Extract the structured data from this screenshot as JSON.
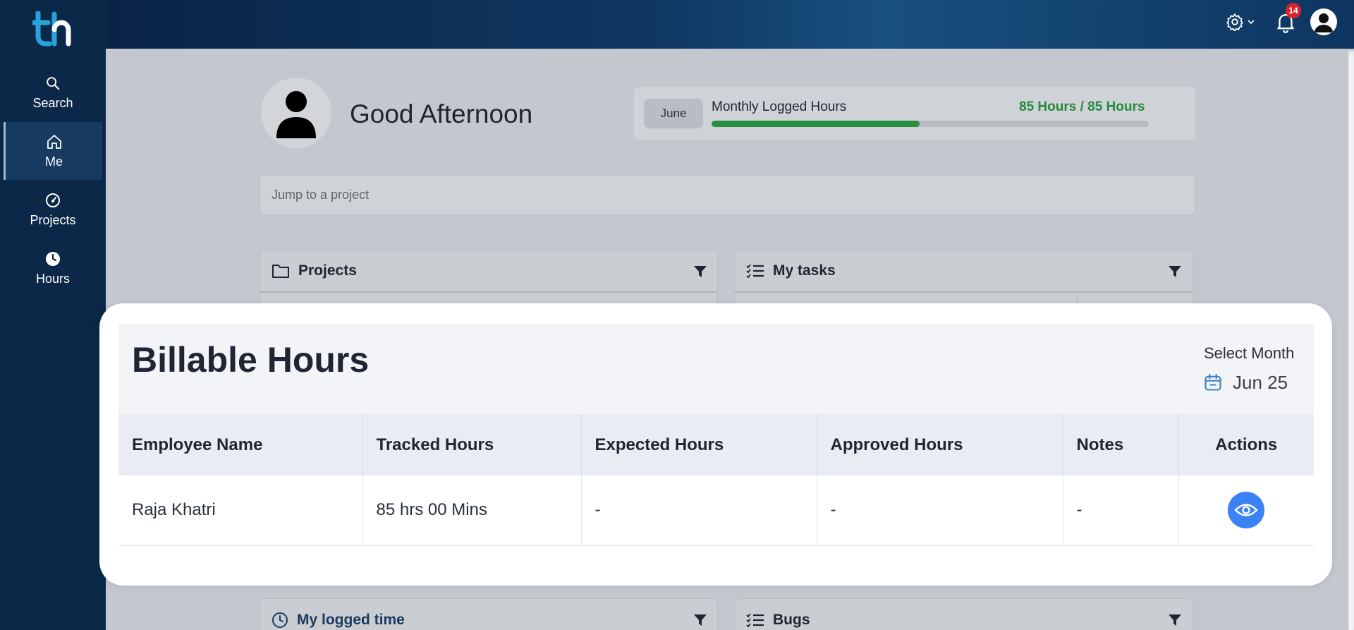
{
  "sidebar": {
    "items": [
      {
        "label": "Search",
        "icon": "search-icon"
      },
      {
        "label": "Me",
        "icon": "home-icon"
      },
      {
        "label": "Projects",
        "icon": "gauge-icon"
      },
      {
        "label": "Hours",
        "icon": "clock-icon"
      }
    ]
  },
  "topbar": {
    "notification_count": "14"
  },
  "greeting": {
    "text": "Good Afternoon"
  },
  "monthly_hours": {
    "month": "June",
    "label": "Monthly Logged Hours",
    "value": "85 Hours / 85 Hours",
    "progress_fraction": 0.475
  },
  "jump": {
    "placeholder": "Jump to a project"
  },
  "panels": {
    "projects": "Projects",
    "my_tasks": "My tasks",
    "my_logged_time": "My logged time",
    "bugs": "Bugs"
  },
  "billable": {
    "title": "Billable Hours",
    "select_month_label": "Select Month",
    "selected_month": "Jun 25",
    "columns": [
      "Employee Name",
      "Tracked Hours",
      "Expected Hours",
      "Approved Hours",
      "Notes",
      "Actions"
    ],
    "rows": [
      {
        "employee": "Raja Khatri",
        "tracked": "85 hrs 00 Mins",
        "expected": "-",
        "approved": "-",
        "notes": "-"
      }
    ]
  },
  "colors": {
    "sidebar_bg": "#0b2848",
    "progress_green": "#2a8f3f",
    "action_blue": "#3b82f6",
    "badge_red": "#d9232e"
  }
}
